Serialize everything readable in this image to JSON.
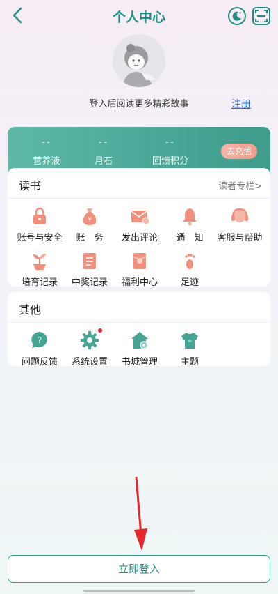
{
  "header": {
    "title": "个人中心",
    "back_icon": "back-arrow-icon",
    "moon_icon": "moon-icon",
    "scan_icon": "scan-icon",
    "accent": "#1f8f82"
  },
  "profile": {
    "login_tip": "登入后阅读更多精彩故事",
    "register_label": "注册"
  },
  "stats": [
    {
      "value": "--",
      "label": "营养液"
    },
    {
      "value": "--",
      "label": "月石"
    },
    {
      "value": "--",
      "label": "回馈积分"
    }
  ],
  "recharge_label": "去充值",
  "reading": {
    "title": "读书",
    "link": "读者专栏>",
    "items": [
      {
        "label": "账号与安全",
        "icon": "lock-icon"
      },
      {
        "label": "账　务",
        "icon": "money-bag-icon"
      },
      {
        "label": "发出评论",
        "icon": "comment-envelope-icon"
      },
      {
        "label": "通　知",
        "icon": "bell-icon"
      },
      {
        "label": "客服与帮助",
        "icon": "headset-icon"
      },
      {
        "label": "培育记录",
        "icon": "sprout-icon"
      },
      {
        "label": "中奖记录",
        "icon": "prize-list-icon"
      },
      {
        "label": "福利中心",
        "icon": "red-envelope-icon"
      },
      {
        "label": "足迹",
        "icon": "footprint-icon"
      }
    ]
  },
  "other": {
    "title": "其他",
    "items": [
      {
        "label": "问题反馈",
        "icon": "question-bubble-icon"
      },
      {
        "label": "系统设置",
        "icon": "gear-icon"
      },
      {
        "label": "书城管理",
        "icon": "house-gear-icon"
      },
      {
        "label": "主题",
        "icon": "shirt-icon"
      }
    ]
  },
  "login_button": "立即登入",
  "colors": {
    "teal": "#45a595",
    "coral": "#f0907c",
    "link": "#2a6fd3",
    "annotation_red": "#e8262e"
  }
}
